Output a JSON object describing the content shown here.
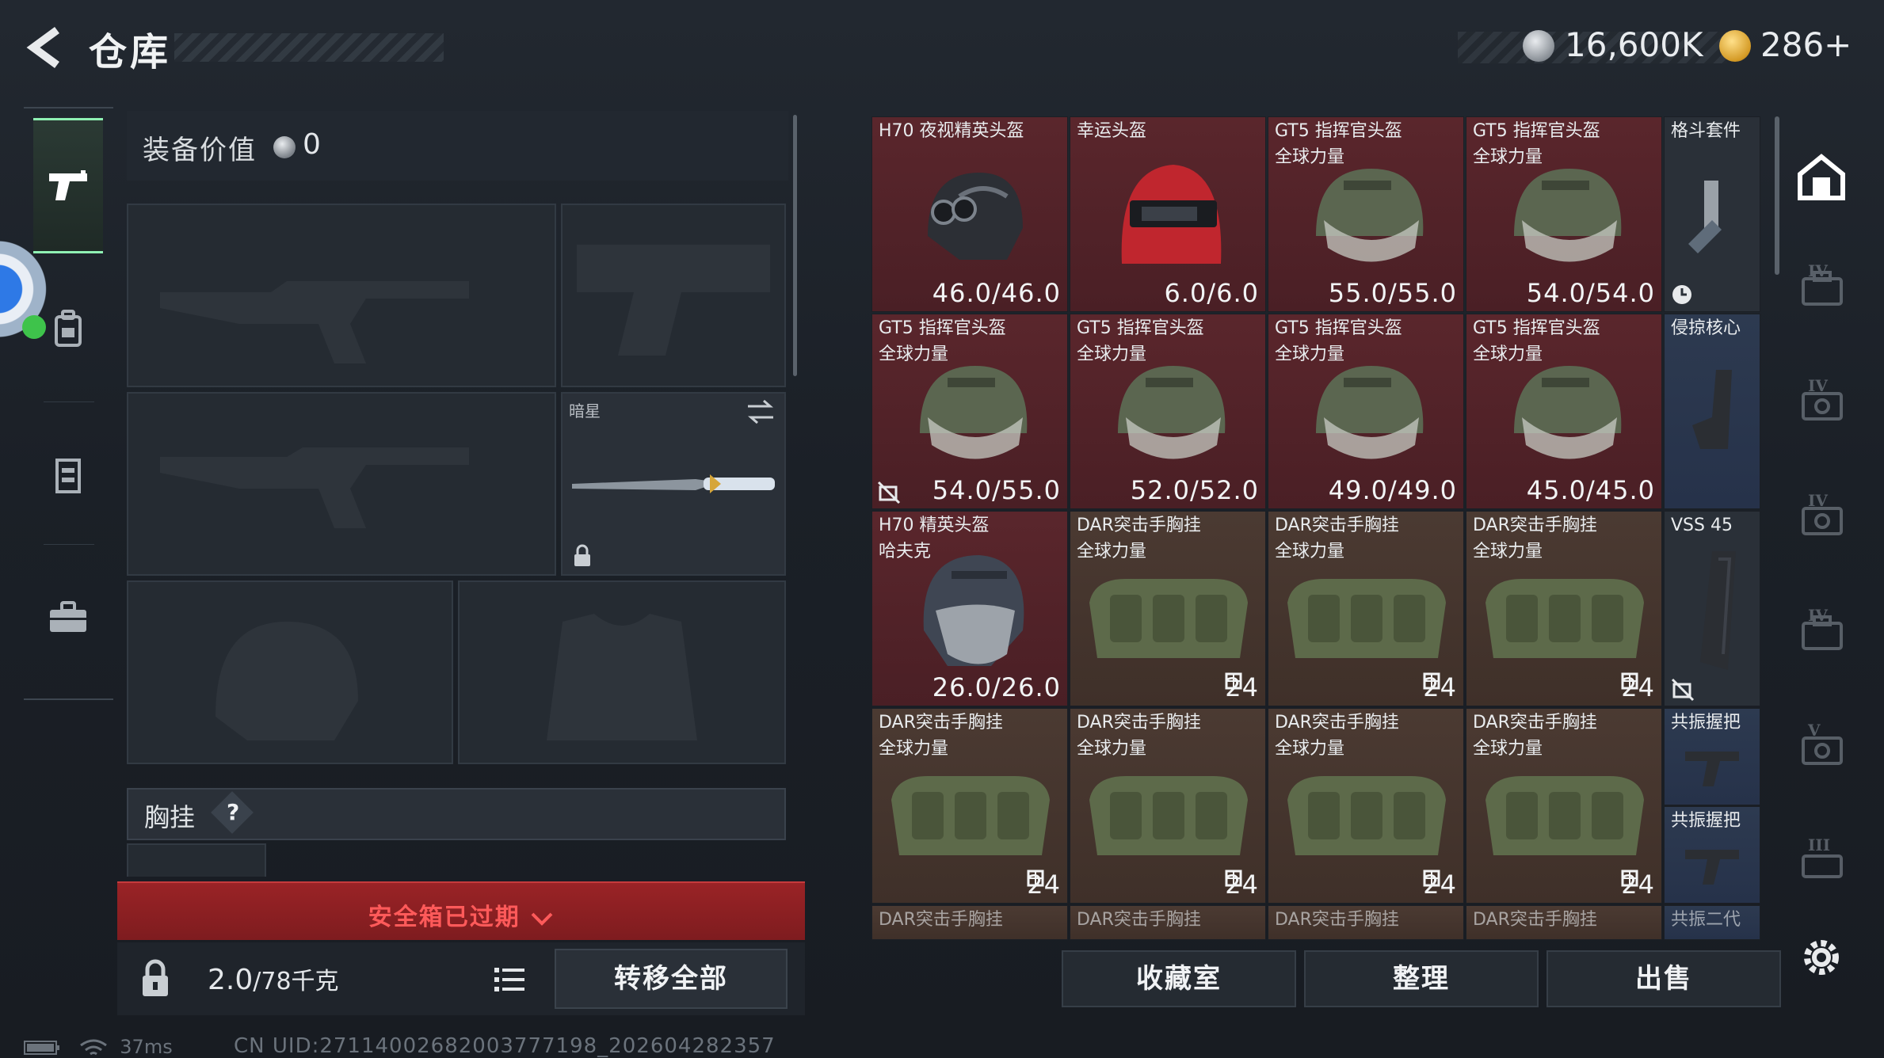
{
  "header": {
    "title": "仓库",
    "currency_silver": "16,600K",
    "currency_gold": "286+"
  },
  "tabs": [
    {
      "name": "weapons",
      "icon": "pistol-icon",
      "active": true
    },
    {
      "name": "backpack",
      "icon": "backpack-icon"
    },
    {
      "name": "armor",
      "icon": "vest-icon"
    },
    {
      "name": "case",
      "icon": "briefcase-icon"
    }
  ],
  "loadout": {
    "value_label": "装备价值",
    "value": "0",
    "melee_label": "暗星",
    "chest_label": "胸挂",
    "help": "?"
  },
  "safebox": {
    "expired_text": "安全箱已过期"
  },
  "footer_left": {
    "weight": "2.0",
    "weight_unit": "/78千克",
    "transfer_all": "转移全部"
  },
  "grid": {
    "rows": [
      [
        {
          "name": "H70 夜视精英头盔",
          "sub": "",
          "value": "46.0/46.0",
          "rarity": "red",
          "kind": "helmet-nv"
        },
        {
          "name": "幸运头盔",
          "sub": "",
          "value": "6.0/6.0",
          "rarity": "red",
          "kind": "helmet-red"
        },
        {
          "name": "GT5 指挥官头盔",
          "sub": "全球力量",
          "value": "55.0/55.0",
          "rarity": "red",
          "kind": "helmet-gt5"
        },
        {
          "name": "GT5 指挥官头盔",
          "sub": "全球力量",
          "value": "54.0/54.0",
          "rarity": "red",
          "kind": "helmet-gt5"
        }
      ],
      [
        {
          "name": "GT5 指挥官头盔",
          "sub": "全球力量",
          "value": "54.0/55.0",
          "rarity": "red",
          "kind": "helmet-gt5"
        },
        {
          "name": "GT5 指挥官头盔",
          "sub": "全球力量",
          "value": "52.0/52.0",
          "rarity": "red",
          "kind": "helmet-gt5"
        },
        {
          "name": "GT5 指挥官头盔",
          "sub": "全球力量",
          "value": "49.0/49.0",
          "rarity": "red",
          "kind": "helmet-gt5"
        },
        {
          "name": "GT5 指挥官头盔",
          "sub": "全球力量",
          "value": "45.0/45.0",
          "rarity": "red",
          "kind": "helmet-gt5"
        }
      ],
      [
        {
          "name": "H70 精英头盔",
          "sub": "哈夫克",
          "value": "26.0/26.0",
          "rarity": "red",
          "kind": "helmet-h70"
        },
        {
          "name": "DAR突击手胸挂",
          "sub": "全球力量",
          "value": "24",
          "rarity": "brown",
          "kind": "vest"
        },
        {
          "name": "DAR突击手胸挂",
          "sub": "全球力量",
          "value": "24",
          "rarity": "brown",
          "kind": "vest"
        },
        {
          "name": "DAR突击手胸挂",
          "sub": "全球力量",
          "value": "24",
          "rarity": "brown",
          "kind": "vest"
        }
      ],
      [
        {
          "name": "DAR突击手胸挂",
          "sub": "全球力量",
          "value": "24",
          "rarity": "brown",
          "kind": "vest"
        },
        {
          "name": "DAR突击手胸挂",
          "sub": "全球力量",
          "value": "24",
          "rarity": "brown",
          "kind": "vest"
        },
        {
          "name": "DAR突击手胸挂",
          "sub": "全球力量",
          "value": "24",
          "rarity": "brown",
          "kind": "vest"
        },
        {
          "name": "DAR突击手胸挂",
          "sub": "全球力量",
          "value": "24",
          "rarity": "brown",
          "kind": "vest"
        }
      ]
    ],
    "partial_row": [
      "DAR突击手胸挂",
      "DAR突击手胸挂",
      "DAR突击手胸挂",
      "DAR突击手胸挂"
    ],
    "side_column": [
      {
        "name": "格斗套件",
        "rarity": "grey"
      },
      {
        "name": "侵掠核心",
        "rarity": "blue"
      },
      {
        "name": "VSS 45",
        "rarity": "grey"
      },
      {
        "name": "共振握把",
        "rarity": "blue"
      },
      {
        "name": "共振握把",
        "rarity": "blue"
      },
      {
        "name": "共振二代",
        "rarity": "blue"
      }
    ]
  },
  "rail": [
    "IV",
    "IV",
    "IV",
    "IV",
    "V",
    "III"
  ],
  "actions": {
    "collection": "收藏室",
    "organize": "整理",
    "sell": "出售"
  },
  "status": {
    "ping": "37ms",
    "uid": "CN UID:27114002682003777198_202604282357"
  },
  "colors": {
    "accent_green": "#8ff0b3",
    "rarity_red": "#5a262c",
    "rarity_brown": "#4b3a32",
    "rarity_blue": "#2d3a50",
    "expired_red": "#9a2326"
  }
}
